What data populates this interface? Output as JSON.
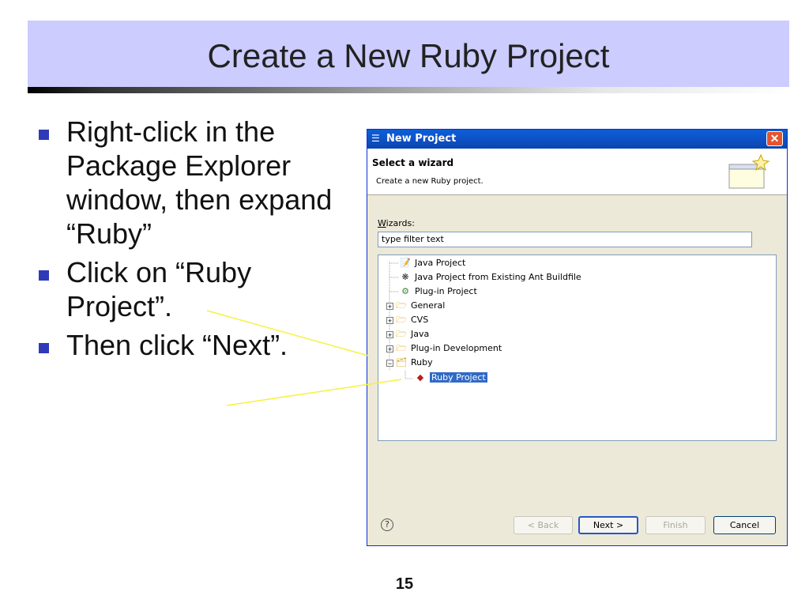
{
  "slide": {
    "title": "Create a New Ruby Project",
    "bullets": [
      "Right-click in the Package Explorer window, then expand “Ruby”",
      "Click on “Ruby Project”.",
      "Then click “Next”."
    ],
    "page_number": "15",
    "colors": {
      "title_band": "#ccccff",
      "bullet": "#2e3ab8",
      "callout": "#f5f242"
    }
  },
  "dialog": {
    "window_title": "New Project",
    "header_title": "Select a wizard",
    "header_subtitle": "Create a new Ruby project.",
    "wizards_label_prefix": "W",
    "wizards_label_rest": "izards:",
    "filter_value": "type filter text",
    "tree": [
      {
        "label": "Java Project",
        "icon": "java-project-icon"
      },
      {
        "label": "Java Project from Existing Ant Buildfile",
        "icon": "ant-icon"
      },
      {
        "label": "Plug-in Project",
        "icon": "plugin-project-icon"
      },
      {
        "label": "General",
        "icon": "folder-icon"
      },
      {
        "label": "CVS",
        "icon": "folder-icon"
      },
      {
        "label": "Java",
        "icon": "folder-icon"
      },
      {
        "label": "Plug-in Development",
        "icon": "folder-icon"
      },
      {
        "label": "Ruby",
        "icon": "folder-icon"
      },
      {
        "label": "Ruby Project",
        "icon": "ruby-project-icon"
      }
    ],
    "buttons": {
      "back": "< Back",
      "next": "Next >",
      "finish": "Finish",
      "cancel": "Cancel"
    },
    "help_symbol": "?",
    "close_symbol": "✕"
  }
}
